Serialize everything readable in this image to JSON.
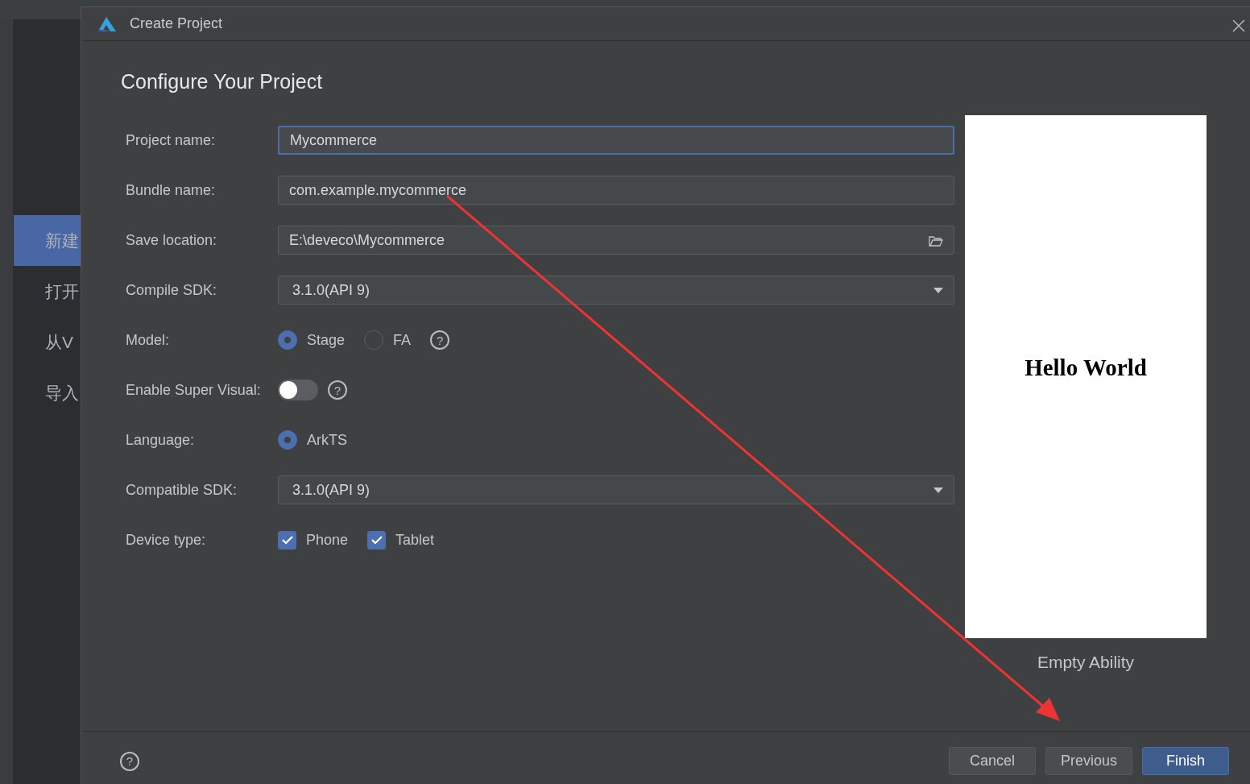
{
  "background_window": {
    "sidebar_items": [
      {
        "label": "新建",
        "selected": true
      },
      {
        "label": "打开",
        "selected": false
      },
      {
        "label": "从V",
        "selected": false
      },
      {
        "label": "导入",
        "selected": false
      }
    ]
  },
  "dialog": {
    "title": "Create Project",
    "heading": "Configure Your Project",
    "fields": [
      {
        "kind": "text",
        "label": "Project name:",
        "value": "Mycommerce",
        "focused": true
      },
      {
        "kind": "text",
        "label": "Bundle name:",
        "value": "com.example.mycommerce",
        "focused": false
      },
      {
        "kind": "folder",
        "label": "Save location:",
        "value": "E:\\deveco\\Mycommerce"
      },
      {
        "kind": "dropdown",
        "label": "Compile SDK:",
        "value": "3.1.0(API 9)"
      },
      {
        "kind": "radio",
        "label": "Model:",
        "help": "?",
        "options": [
          {
            "label": "Stage",
            "selected": true
          },
          {
            "label": "FA",
            "selected": false
          }
        ]
      },
      {
        "kind": "toggle",
        "label": "Enable Super Visual:",
        "on": false,
        "help": "?"
      },
      {
        "kind": "radio",
        "label": "Language:",
        "options": [
          {
            "label": "ArkTS",
            "selected": true
          }
        ]
      },
      {
        "kind": "dropdown",
        "label": "Compatible SDK:",
        "value": "3.1.0(API 9)"
      },
      {
        "kind": "checkbox",
        "label": "Device type:",
        "options": [
          {
            "label": "Phone",
            "checked": true
          },
          {
            "label": "Tablet",
            "checked": true
          }
        ]
      }
    ],
    "preview": {
      "text": "Hello World",
      "caption": "Empty Ability"
    },
    "footer": {
      "help": "?",
      "buttons": [
        {
          "label": "Cancel",
          "primary": false
        },
        {
          "label": "Previous",
          "primary": false
        },
        {
          "label": "Finish",
          "primary": true
        }
      ]
    }
  },
  "annotation": {
    "kind": "arrow",
    "color": "#ee3333"
  }
}
